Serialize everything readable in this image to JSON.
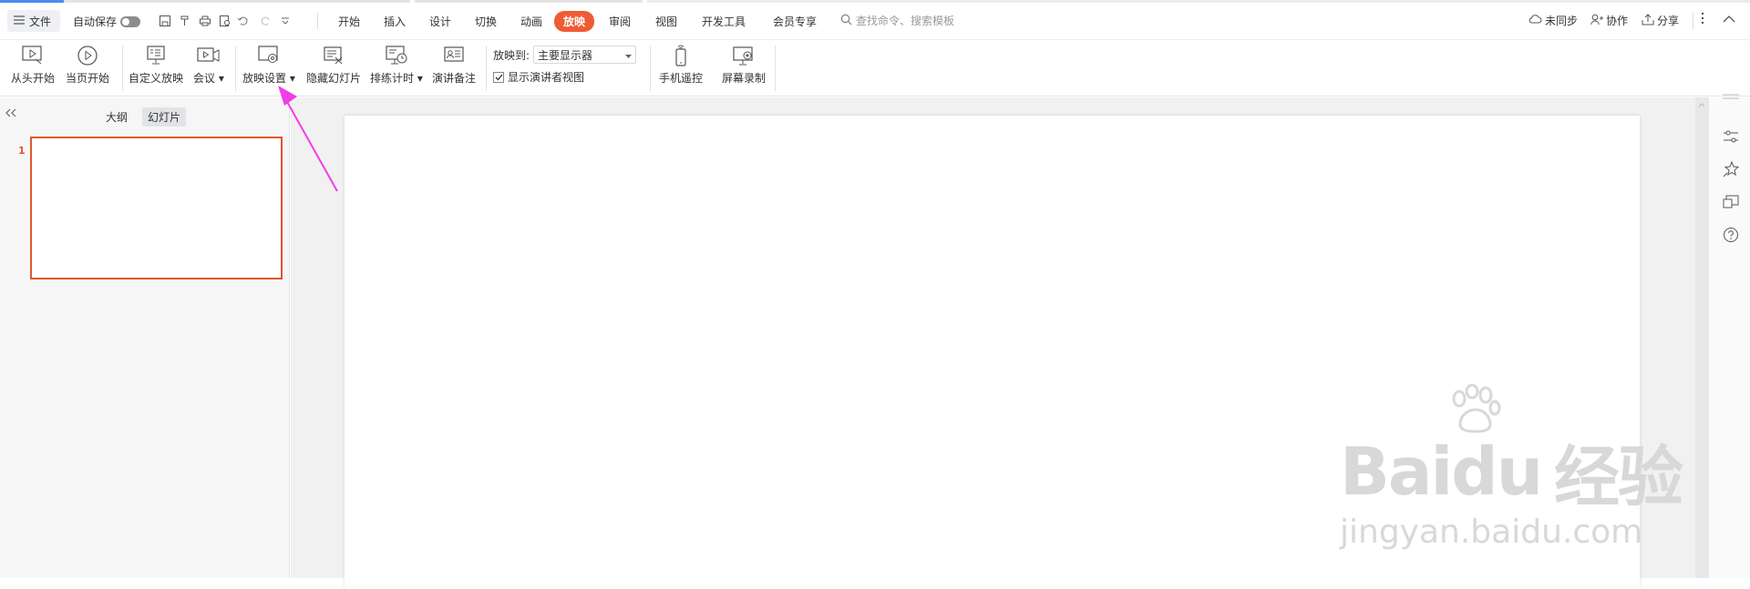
{
  "menu": {
    "file": "文件",
    "autosave": "自动保存",
    "tabs": [
      "开始",
      "插入",
      "设计",
      "切换",
      "动画",
      "放映",
      "审阅",
      "视图",
      "开发工具",
      "会员专享"
    ],
    "active_tab": "放映",
    "search_placeholder": "查找命令、搜索模板",
    "right": {
      "sync": "未同步",
      "collab": "协作",
      "share": "分享"
    }
  },
  "ribbon": {
    "from_start": "从头开始",
    "from_current": "当页开始",
    "custom_show": "自定义放映",
    "meeting": "会议",
    "show_settings": "放映设置",
    "hide_slide": "隐藏幻灯片",
    "rehearse_timing": "排练计时",
    "speaker_notes": "演讲备注",
    "play_to_label": "放映到:",
    "play_to_value": "主要显示器",
    "presenter_view_label": "显示演讲者视图",
    "presenter_view_checked": true,
    "phone_remote": "手机遥控",
    "screen_record": "屏幕录制"
  },
  "left_panel": {
    "tabs": [
      "大纲",
      "幻灯片"
    ],
    "active_tab": "幻灯片",
    "slides": [
      {
        "number": "1"
      }
    ]
  },
  "watermark": {
    "main_a": "Bai",
    "main_b": "du",
    "main_c": "经验",
    "sub": "jingyan.baidu.com"
  },
  "colors": {
    "accent": "#ee5c36",
    "selection": "#e0562c",
    "annotation_arrow": "#f23de6"
  }
}
